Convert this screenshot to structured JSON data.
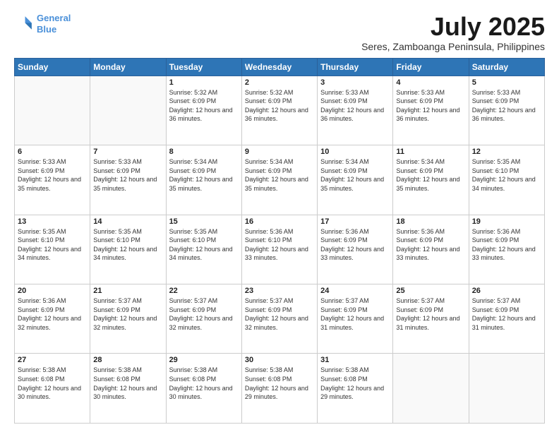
{
  "header": {
    "logo_line1": "General",
    "logo_line2": "Blue",
    "month": "July 2025",
    "location": "Seres, Zamboanga Peninsula, Philippines"
  },
  "days_of_week": [
    "Sunday",
    "Monday",
    "Tuesday",
    "Wednesday",
    "Thursday",
    "Friday",
    "Saturday"
  ],
  "weeks": [
    [
      {
        "day": "",
        "info": ""
      },
      {
        "day": "",
        "info": ""
      },
      {
        "day": "1",
        "info": "Sunrise: 5:32 AM\nSunset: 6:09 PM\nDaylight: 12 hours and 36 minutes."
      },
      {
        "day": "2",
        "info": "Sunrise: 5:32 AM\nSunset: 6:09 PM\nDaylight: 12 hours and 36 minutes."
      },
      {
        "day": "3",
        "info": "Sunrise: 5:33 AM\nSunset: 6:09 PM\nDaylight: 12 hours and 36 minutes."
      },
      {
        "day": "4",
        "info": "Sunrise: 5:33 AM\nSunset: 6:09 PM\nDaylight: 12 hours and 36 minutes."
      },
      {
        "day": "5",
        "info": "Sunrise: 5:33 AM\nSunset: 6:09 PM\nDaylight: 12 hours and 36 minutes."
      }
    ],
    [
      {
        "day": "6",
        "info": "Sunrise: 5:33 AM\nSunset: 6:09 PM\nDaylight: 12 hours and 35 minutes."
      },
      {
        "day": "7",
        "info": "Sunrise: 5:33 AM\nSunset: 6:09 PM\nDaylight: 12 hours and 35 minutes."
      },
      {
        "day": "8",
        "info": "Sunrise: 5:34 AM\nSunset: 6:09 PM\nDaylight: 12 hours and 35 minutes."
      },
      {
        "day": "9",
        "info": "Sunrise: 5:34 AM\nSunset: 6:09 PM\nDaylight: 12 hours and 35 minutes."
      },
      {
        "day": "10",
        "info": "Sunrise: 5:34 AM\nSunset: 6:09 PM\nDaylight: 12 hours and 35 minutes."
      },
      {
        "day": "11",
        "info": "Sunrise: 5:34 AM\nSunset: 6:09 PM\nDaylight: 12 hours and 35 minutes."
      },
      {
        "day": "12",
        "info": "Sunrise: 5:35 AM\nSunset: 6:10 PM\nDaylight: 12 hours and 34 minutes."
      }
    ],
    [
      {
        "day": "13",
        "info": "Sunrise: 5:35 AM\nSunset: 6:10 PM\nDaylight: 12 hours and 34 minutes."
      },
      {
        "day": "14",
        "info": "Sunrise: 5:35 AM\nSunset: 6:10 PM\nDaylight: 12 hours and 34 minutes."
      },
      {
        "day": "15",
        "info": "Sunrise: 5:35 AM\nSunset: 6:10 PM\nDaylight: 12 hours and 34 minutes."
      },
      {
        "day": "16",
        "info": "Sunrise: 5:36 AM\nSunset: 6:10 PM\nDaylight: 12 hours and 33 minutes."
      },
      {
        "day": "17",
        "info": "Sunrise: 5:36 AM\nSunset: 6:09 PM\nDaylight: 12 hours and 33 minutes."
      },
      {
        "day": "18",
        "info": "Sunrise: 5:36 AM\nSunset: 6:09 PM\nDaylight: 12 hours and 33 minutes."
      },
      {
        "day": "19",
        "info": "Sunrise: 5:36 AM\nSunset: 6:09 PM\nDaylight: 12 hours and 33 minutes."
      }
    ],
    [
      {
        "day": "20",
        "info": "Sunrise: 5:36 AM\nSunset: 6:09 PM\nDaylight: 12 hours and 32 minutes."
      },
      {
        "day": "21",
        "info": "Sunrise: 5:37 AM\nSunset: 6:09 PM\nDaylight: 12 hours and 32 minutes."
      },
      {
        "day": "22",
        "info": "Sunrise: 5:37 AM\nSunset: 6:09 PM\nDaylight: 12 hours and 32 minutes."
      },
      {
        "day": "23",
        "info": "Sunrise: 5:37 AM\nSunset: 6:09 PM\nDaylight: 12 hours and 32 minutes."
      },
      {
        "day": "24",
        "info": "Sunrise: 5:37 AM\nSunset: 6:09 PM\nDaylight: 12 hours and 31 minutes."
      },
      {
        "day": "25",
        "info": "Sunrise: 5:37 AM\nSunset: 6:09 PM\nDaylight: 12 hours and 31 minutes."
      },
      {
        "day": "26",
        "info": "Sunrise: 5:37 AM\nSunset: 6:09 PM\nDaylight: 12 hours and 31 minutes."
      }
    ],
    [
      {
        "day": "27",
        "info": "Sunrise: 5:38 AM\nSunset: 6:08 PM\nDaylight: 12 hours and 30 minutes."
      },
      {
        "day": "28",
        "info": "Sunrise: 5:38 AM\nSunset: 6:08 PM\nDaylight: 12 hours and 30 minutes."
      },
      {
        "day": "29",
        "info": "Sunrise: 5:38 AM\nSunset: 6:08 PM\nDaylight: 12 hours and 30 minutes."
      },
      {
        "day": "30",
        "info": "Sunrise: 5:38 AM\nSunset: 6:08 PM\nDaylight: 12 hours and 29 minutes."
      },
      {
        "day": "31",
        "info": "Sunrise: 5:38 AM\nSunset: 6:08 PM\nDaylight: 12 hours and 29 minutes."
      },
      {
        "day": "",
        "info": ""
      },
      {
        "day": "",
        "info": ""
      }
    ]
  ]
}
